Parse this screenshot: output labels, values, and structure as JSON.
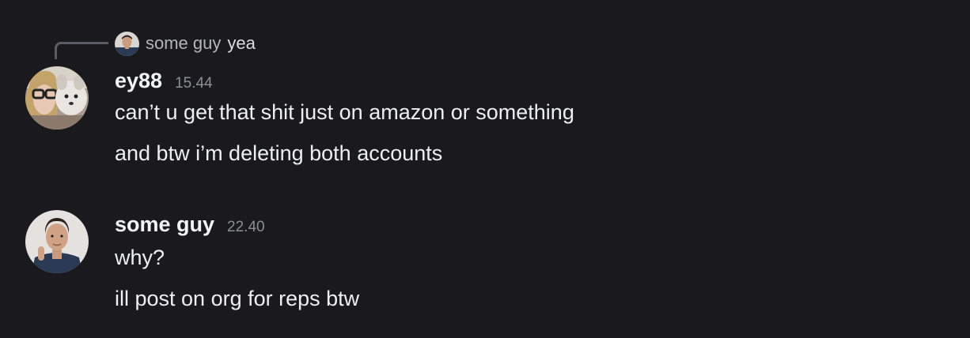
{
  "reply": {
    "author": "some guy",
    "text": "yea"
  },
  "messages": [
    {
      "author": "ey88",
      "timestamp": "15.44",
      "lines": [
        "can’t u get that shit just on amazon or something",
        "and btw i’m deleting both accounts"
      ]
    },
    {
      "author": "some guy",
      "timestamp": "22.40",
      "lines": [
        "why?",
        "ill post on org for reps btw"
      ]
    }
  ]
}
